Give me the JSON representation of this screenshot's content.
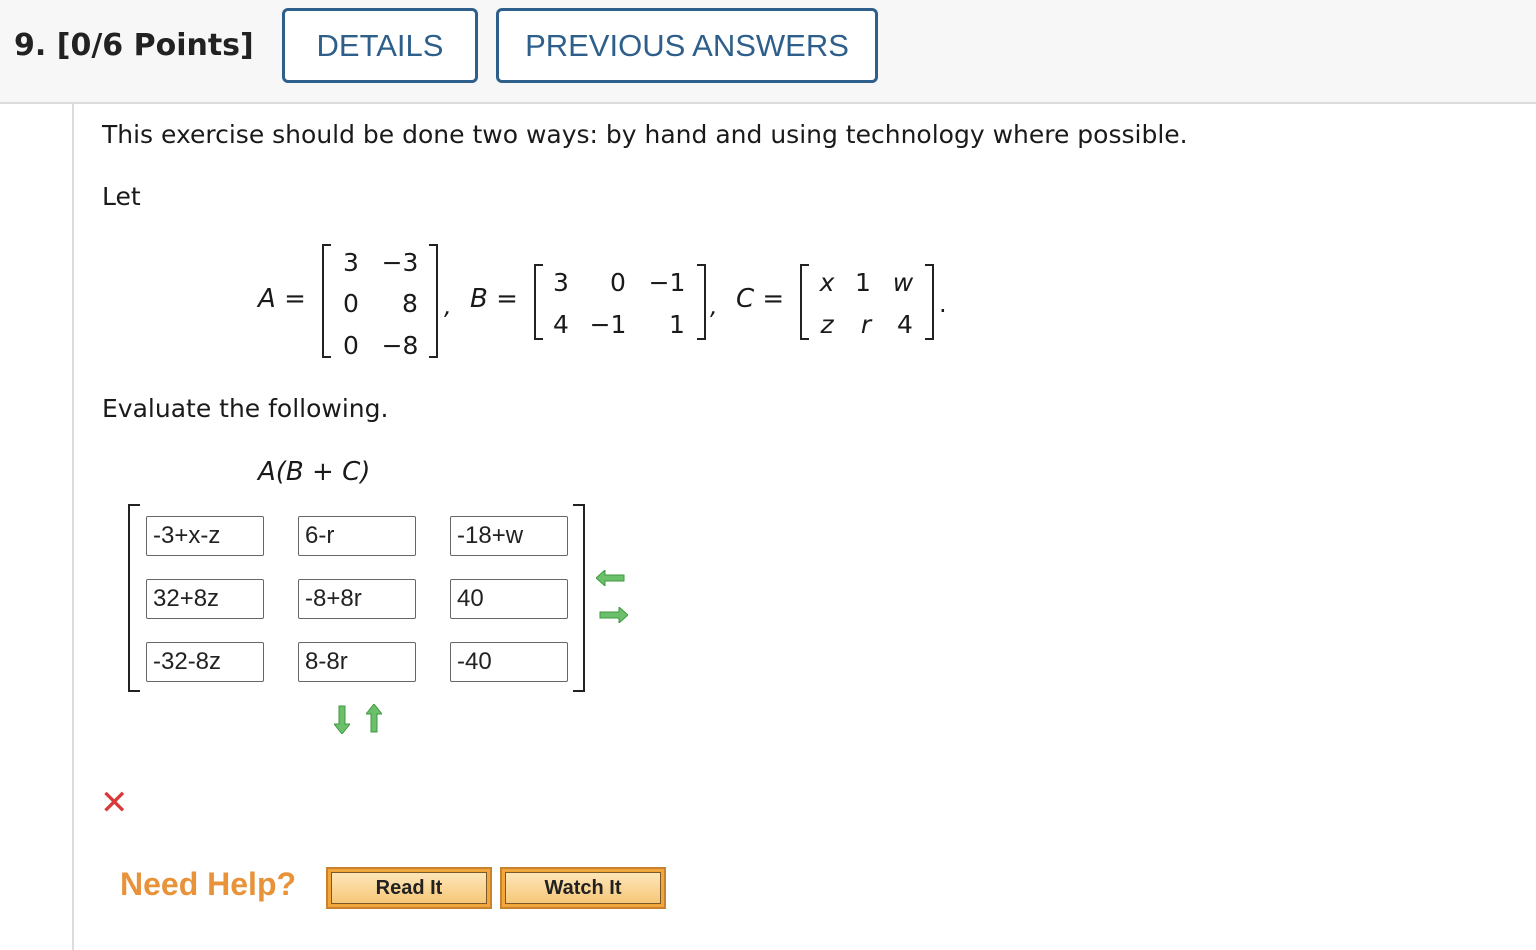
{
  "header": {
    "question_number": "9.",
    "points": "[0/6 Points]",
    "details_label": "DETAILS",
    "previous_answers_label": "PREVIOUS ANSWERS"
  },
  "problem": {
    "instruction": "This exercise should be done two ways: by hand and using technology where possible.",
    "let_label": "Let",
    "matrix_A_label": "A",
    "matrix_B_label": "B",
    "matrix_C_label": "C",
    "equals": "=",
    "matrix_A": [
      [
        "3",
        "−3"
      ],
      [
        "0",
        "8"
      ],
      [
        "0",
        "−8"
      ]
    ],
    "matrix_B": [
      [
        "3",
        "0",
        "−1"
      ],
      [
        "4",
        "−1",
        "1"
      ]
    ],
    "matrix_C": [
      [
        "x",
        "1",
        "w"
      ],
      [
        "z",
        "r",
        "4"
      ]
    ],
    "evaluate_text": "Evaluate the following.",
    "expression": "A(B + C)"
  },
  "answer": {
    "cells": [
      [
        "-3+x-z",
        "6-r",
        "-18+w"
      ],
      [
        "32+8z",
        "-8+8r",
        "40"
      ],
      [
        "-32-8z",
        "8-8r",
        "-40"
      ]
    ],
    "status_icon": "incorrect-x-icon"
  },
  "help": {
    "need_help_label": "Need Help?",
    "read_it_label": "Read It",
    "watch_it_label": "Watch It"
  },
  "colors": {
    "button_border": "#2e5f8a",
    "incorrect": "#d63a3a",
    "need_help": "#e8923a",
    "arrow_green": "#3d9a3d"
  }
}
